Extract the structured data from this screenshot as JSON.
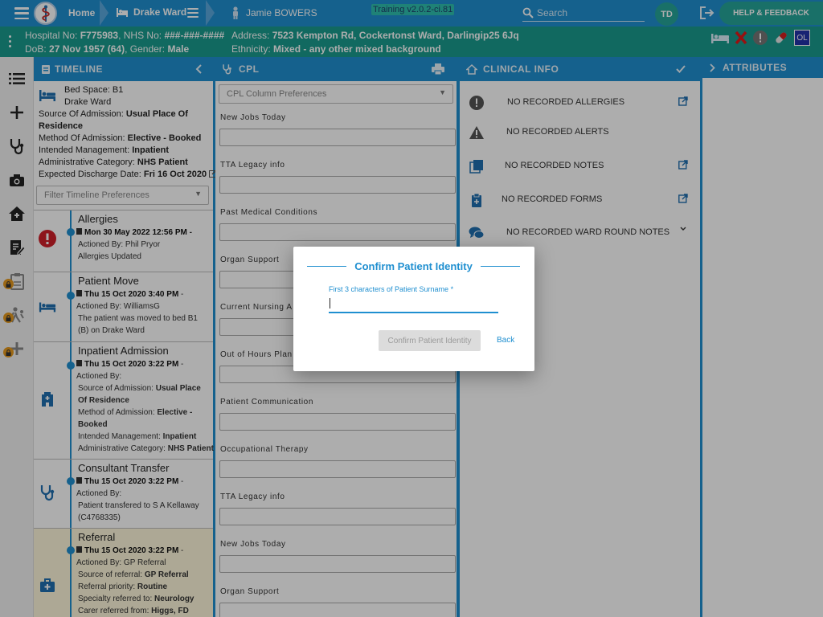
{
  "topbar": {
    "home_label": "Home",
    "ward_label": "Drake Ward",
    "patient_name": "Jamie BOWERS",
    "version": "Training v2.0.2-ci.81",
    "search_placeholder": "Search",
    "user_initials": "TD",
    "help_label": "HELP & FEEDBACK"
  },
  "banner": {
    "hospital_no_label": "Hospital No:",
    "hospital_no": "F775983",
    "nhs_no_label": "NHS No:",
    "nhs_no": "###-###-####",
    "dob_label": "DoB:",
    "dob": "27 Nov 1957 (64)",
    "gender_label": "Gender:",
    "gender": "Male",
    "address_label": "Address:",
    "address": "7523 Kempton Rd, Cockertonst Ward, Darlingip25 6Jq",
    "ethnicity_label": "Ethnicity:",
    "ethnicity": "Mixed - any other mixed background",
    "ol_badge": "OL"
  },
  "timeline": {
    "header": "TIMELINE",
    "bed_space": "Bed Space: B1",
    "ward": "Drake Ward",
    "source_label": "Source Of Admission:",
    "source": "Usual Place Of Residence",
    "method_label": "Method Of Admission:",
    "method": "Elective - Booked",
    "intended_label": "Intended Management:",
    "intended": "Inpatient",
    "admin_label": "Administrative Category:",
    "admin": "NHS Patient",
    "discharge_label": "Expected Discharge Date:",
    "discharge": "Fri 16 Oct 2020",
    "filter_placeholder": "Filter Timeline Preferences",
    "events": [
      {
        "title": "Allergies",
        "date": "Mon 30 May 2022 12:56 PM",
        "suffix": " -",
        "lines": [
          "Actioned By: Phil Pryor",
          "Allergies Updated"
        ]
      },
      {
        "title": "Patient Move",
        "date": "Thu 15 Oct 2020 3:40 PM",
        "suffix": " - Actioned By: WilliamsG",
        "lines": [
          "The patient was moved to bed B1 (B) on Drake Ward"
        ]
      },
      {
        "title": "Inpatient Admission",
        "date": "Thu 15 Oct 2020 3:22 PM",
        "suffix": " - Actioned By:",
        "lines": [
          "Source of Admission: ",
          "Method of Admission: ",
          "Intended Management: ",
          "Administrative Category: "
        ],
        "values": [
          "Usual Place Of Residence",
          "Elective - Booked",
          "Inpatient",
          "NHS Patient"
        ]
      },
      {
        "title": "Consultant Transfer",
        "date": "Thu 15 Oct 2020 3:22 PM",
        "suffix": " - Actioned By:",
        "lines": [
          "Patient transfered to S A Kellaway (C4768335)"
        ]
      },
      {
        "title": "Referral",
        "date": "Thu 15 Oct 2020 3:22 PM",
        "suffix": " - Actioned By: GP Referral",
        "lines": [
          "Source of referral: ",
          "Referral priority: ",
          "Specialty referred to: ",
          "Carer referred from: "
        ],
        "values": [
          "GP Referral",
          "Routine",
          "Neurology",
          "Higgs, FD"
        ]
      }
    ]
  },
  "cpl": {
    "header": "CPL",
    "column_prefs": "CPL Column Preferences",
    "fields": [
      "New Jobs Today",
      "TTA Legacy info",
      "Past Medical Conditions",
      "Organ Support",
      "Current Nursing A",
      "Out of Hours Plan",
      "Patient Communication",
      "Occupational Therapy",
      "TTA Legacy info",
      "New Jobs Today",
      "Organ Support"
    ]
  },
  "clinical": {
    "header": "CLINICAL INFO",
    "allergies": "NO RECORDED ALLERGIES",
    "alerts": "NO RECORDED ALERTS",
    "notes": "NO RECORDED NOTES",
    "forms": "NO RECORDED FORMS",
    "ward_round": "NO RECORDED WARD ROUND NOTES"
  },
  "attributes": {
    "header": "ATTRIBUTES"
  },
  "modal": {
    "title": "Confirm Patient Identity",
    "field_label": "First 3 characters of Patient Surname *",
    "field_value": "",
    "confirm_label": "Confirm Patient Identity",
    "back_label": "Back"
  },
  "colors": {
    "primary": "#1f8fd0",
    "banner": "#1a9b8e",
    "allergy_red": "#d0202a",
    "referral_bg": "#fff8dc"
  }
}
